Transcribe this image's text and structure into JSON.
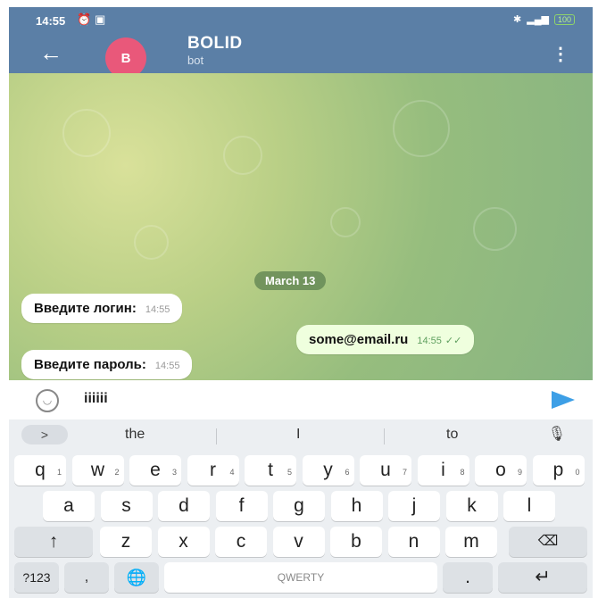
{
  "status": {
    "time": "14:55",
    "battery": "100"
  },
  "header": {
    "avatar_letter": "B",
    "title": "BOLID",
    "subtitle": "bot"
  },
  "chat": {
    "date": "March 13",
    "messages": [
      {
        "text": "Введите логин:",
        "time": "14:55",
        "dir": "in"
      },
      {
        "text": "some@email.ru",
        "time": "14:55",
        "dir": "out"
      },
      {
        "text": "Введите пароль:",
        "time": "14:55",
        "dir": "in"
      }
    ]
  },
  "input": {
    "value": "iiiiii"
  },
  "keyboard": {
    "suggestions": [
      "the",
      "I",
      "to"
    ],
    "row1": [
      {
        "k": "q",
        "n": "1"
      },
      {
        "k": "w",
        "n": "2"
      },
      {
        "k": "e",
        "n": "3"
      },
      {
        "k": "r",
        "n": "4"
      },
      {
        "k": "t",
        "n": "5"
      },
      {
        "k": "y",
        "n": "6"
      },
      {
        "k": "u",
        "n": "7"
      },
      {
        "k": "i",
        "n": "8"
      },
      {
        "k": "o",
        "n": "9"
      },
      {
        "k": "p",
        "n": "0"
      }
    ],
    "row2": [
      "a",
      "s",
      "d",
      "f",
      "g",
      "h",
      "j",
      "k",
      "l"
    ],
    "row3": [
      "z",
      "x",
      "c",
      "v",
      "b",
      "n",
      "m"
    ],
    "symbols_label": "?123",
    "space_label": "QWERTY",
    "period_label": "."
  }
}
